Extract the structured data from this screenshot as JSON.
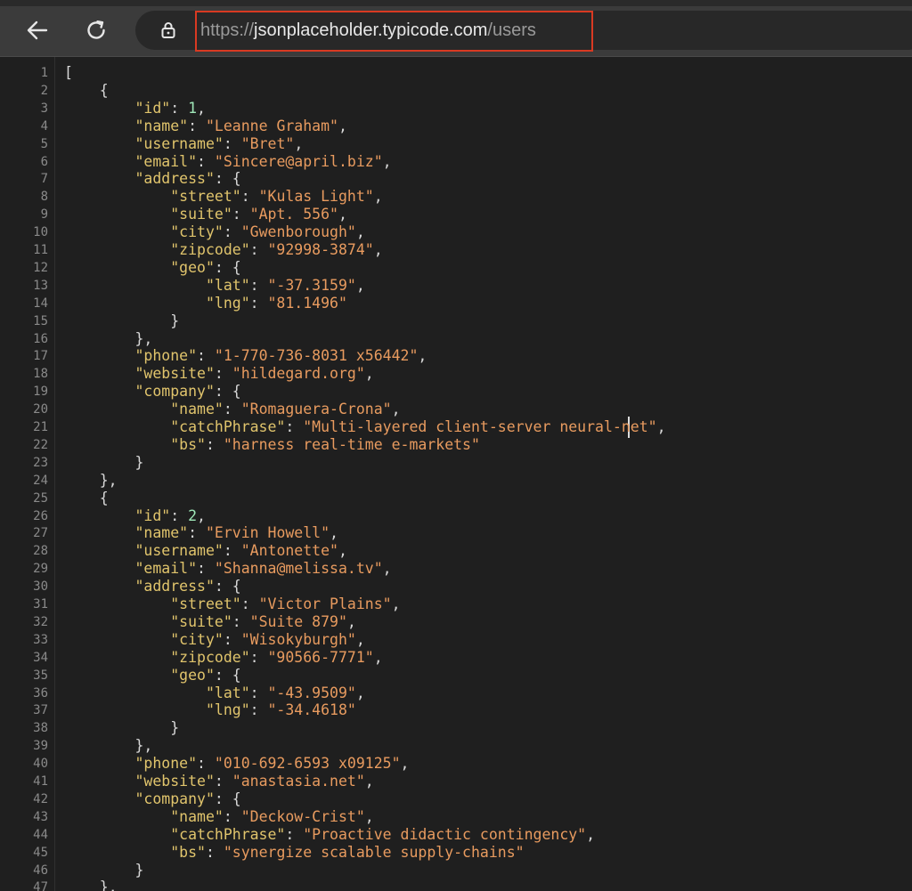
{
  "browser": {
    "url_scheme": "https://",
    "url_host": "jsonplaceholder.typicode.com",
    "url_path": "/users",
    "back_icon": "arrow-left-icon",
    "reload_icon": "reload-icon",
    "lock_icon": "lock-icon",
    "highlight_color": "#d93a22"
  },
  "viewer": {
    "lines": [
      {
        "n": "1",
        "t": [
          {
            "c": "p",
            "v": "["
          }
        ]
      },
      {
        "n": "2",
        "t": [
          {
            "c": "p",
            "v": "    {"
          }
        ]
      },
      {
        "n": "3",
        "t": [
          {
            "c": "p",
            "v": "        "
          },
          {
            "c": "k",
            "v": "\"id\""
          },
          {
            "c": "p",
            "v": ": "
          },
          {
            "c": "n",
            "v": "1"
          },
          {
            "c": "p",
            "v": ","
          }
        ]
      },
      {
        "n": "4",
        "t": [
          {
            "c": "p",
            "v": "        "
          },
          {
            "c": "k",
            "v": "\"name\""
          },
          {
            "c": "p",
            "v": ": "
          },
          {
            "c": "s",
            "v": "\"Leanne Graham\""
          },
          {
            "c": "p",
            "v": ","
          }
        ]
      },
      {
        "n": "5",
        "t": [
          {
            "c": "p",
            "v": "        "
          },
          {
            "c": "k",
            "v": "\"username\""
          },
          {
            "c": "p",
            "v": ": "
          },
          {
            "c": "s",
            "v": "\"Bret\""
          },
          {
            "c": "p",
            "v": ","
          }
        ]
      },
      {
        "n": "6",
        "t": [
          {
            "c": "p",
            "v": "        "
          },
          {
            "c": "k",
            "v": "\"email\""
          },
          {
            "c": "p",
            "v": ": "
          },
          {
            "c": "s",
            "v": "\"Sincere@april.biz\""
          },
          {
            "c": "p",
            "v": ","
          }
        ]
      },
      {
        "n": "7",
        "t": [
          {
            "c": "p",
            "v": "        "
          },
          {
            "c": "k",
            "v": "\"address\""
          },
          {
            "c": "p",
            "v": ": {"
          }
        ]
      },
      {
        "n": "8",
        "t": [
          {
            "c": "p",
            "v": "            "
          },
          {
            "c": "k",
            "v": "\"street\""
          },
          {
            "c": "p",
            "v": ": "
          },
          {
            "c": "s",
            "v": "\"Kulas Light\""
          },
          {
            "c": "p",
            "v": ","
          }
        ]
      },
      {
        "n": "9",
        "t": [
          {
            "c": "p",
            "v": "            "
          },
          {
            "c": "k",
            "v": "\"suite\""
          },
          {
            "c": "p",
            "v": ": "
          },
          {
            "c": "s",
            "v": "\"Apt. 556\""
          },
          {
            "c": "p",
            "v": ","
          }
        ]
      },
      {
        "n": "10",
        "t": [
          {
            "c": "p",
            "v": "            "
          },
          {
            "c": "k",
            "v": "\"city\""
          },
          {
            "c": "p",
            "v": ": "
          },
          {
            "c": "s",
            "v": "\"Gwenborough\""
          },
          {
            "c": "p",
            "v": ","
          }
        ]
      },
      {
        "n": "11",
        "t": [
          {
            "c": "p",
            "v": "            "
          },
          {
            "c": "k",
            "v": "\"zipcode\""
          },
          {
            "c": "p",
            "v": ": "
          },
          {
            "c": "s",
            "v": "\"92998-3874\""
          },
          {
            "c": "p",
            "v": ","
          }
        ]
      },
      {
        "n": "12",
        "t": [
          {
            "c": "p",
            "v": "            "
          },
          {
            "c": "k",
            "v": "\"geo\""
          },
          {
            "c": "p",
            "v": ": {"
          }
        ]
      },
      {
        "n": "13",
        "t": [
          {
            "c": "p",
            "v": "                "
          },
          {
            "c": "k",
            "v": "\"lat\""
          },
          {
            "c": "p",
            "v": ": "
          },
          {
            "c": "s",
            "v": "\"-37.3159\""
          },
          {
            "c": "p",
            "v": ","
          }
        ]
      },
      {
        "n": "14",
        "t": [
          {
            "c": "p",
            "v": "                "
          },
          {
            "c": "k",
            "v": "\"lng\""
          },
          {
            "c": "p",
            "v": ": "
          },
          {
            "c": "s",
            "v": "\"81.1496\""
          }
        ]
      },
      {
        "n": "15",
        "t": [
          {
            "c": "p",
            "v": "            }"
          }
        ]
      },
      {
        "n": "16",
        "t": [
          {
            "c": "p",
            "v": "        },"
          }
        ]
      },
      {
        "n": "17",
        "t": [
          {
            "c": "p",
            "v": "        "
          },
          {
            "c": "k",
            "v": "\"phone\""
          },
          {
            "c": "p",
            "v": ": "
          },
          {
            "c": "s",
            "v": "\"1-770-736-8031 x56442\""
          },
          {
            "c": "p",
            "v": ","
          }
        ]
      },
      {
        "n": "18",
        "t": [
          {
            "c": "p",
            "v": "        "
          },
          {
            "c": "k",
            "v": "\"website\""
          },
          {
            "c": "p",
            "v": ": "
          },
          {
            "c": "s",
            "v": "\"hildegard.org\""
          },
          {
            "c": "p",
            "v": ","
          }
        ]
      },
      {
        "n": "19",
        "t": [
          {
            "c": "p",
            "v": "        "
          },
          {
            "c": "k",
            "v": "\"company\""
          },
          {
            "c": "p",
            "v": ": {"
          }
        ]
      },
      {
        "n": "20",
        "t": [
          {
            "c": "p",
            "v": "            "
          },
          {
            "c": "k",
            "v": "\"name\""
          },
          {
            "c": "p",
            "v": ": "
          },
          {
            "c": "s",
            "v": "\"Romaguera-Crona\""
          },
          {
            "c": "p",
            "v": ","
          }
        ]
      },
      {
        "n": "21",
        "t": [
          {
            "c": "p",
            "v": "            "
          },
          {
            "c": "k",
            "v": "\"catchPhrase\""
          },
          {
            "c": "p",
            "v": ": "
          },
          {
            "c": "s",
            "v": "\"Multi-layered client-server neural-net\""
          },
          {
            "c": "p",
            "v": ","
          }
        ]
      },
      {
        "n": "22",
        "t": [
          {
            "c": "p",
            "v": "            "
          },
          {
            "c": "k",
            "v": "\"bs\""
          },
          {
            "c": "p",
            "v": ": "
          },
          {
            "c": "s",
            "v": "\"harness real-time e-markets\""
          }
        ]
      },
      {
        "n": "23",
        "t": [
          {
            "c": "p",
            "v": "        }"
          }
        ]
      },
      {
        "n": "24",
        "t": [
          {
            "c": "p",
            "v": "    },"
          }
        ]
      },
      {
        "n": "25",
        "t": [
          {
            "c": "p",
            "v": "    {"
          }
        ]
      },
      {
        "n": "26",
        "t": [
          {
            "c": "p",
            "v": "        "
          },
          {
            "c": "k",
            "v": "\"id\""
          },
          {
            "c": "p",
            "v": ": "
          },
          {
            "c": "n",
            "v": "2"
          },
          {
            "c": "p",
            "v": ","
          }
        ]
      },
      {
        "n": "27",
        "t": [
          {
            "c": "p",
            "v": "        "
          },
          {
            "c": "k",
            "v": "\"name\""
          },
          {
            "c": "p",
            "v": ": "
          },
          {
            "c": "s",
            "v": "\"Ervin Howell\""
          },
          {
            "c": "p",
            "v": ","
          }
        ]
      },
      {
        "n": "28",
        "t": [
          {
            "c": "p",
            "v": "        "
          },
          {
            "c": "k",
            "v": "\"username\""
          },
          {
            "c": "p",
            "v": ": "
          },
          {
            "c": "s",
            "v": "\"Antonette\""
          },
          {
            "c": "p",
            "v": ","
          }
        ]
      },
      {
        "n": "29",
        "t": [
          {
            "c": "p",
            "v": "        "
          },
          {
            "c": "k",
            "v": "\"email\""
          },
          {
            "c": "p",
            "v": ": "
          },
          {
            "c": "s",
            "v": "\"Shanna@melissa.tv\""
          },
          {
            "c": "p",
            "v": ","
          }
        ]
      },
      {
        "n": "30",
        "t": [
          {
            "c": "p",
            "v": "        "
          },
          {
            "c": "k",
            "v": "\"address\""
          },
          {
            "c": "p",
            "v": ": {"
          }
        ]
      },
      {
        "n": "31",
        "t": [
          {
            "c": "p",
            "v": "            "
          },
          {
            "c": "k",
            "v": "\"street\""
          },
          {
            "c": "p",
            "v": ": "
          },
          {
            "c": "s",
            "v": "\"Victor Plains\""
          },
          {
            "c": "p",
            "v": ","
          }
        ]
      },
      {
        "n": "32",
        "t": [
          {
            "c": "p",
            "v": "            "
          },
          {
            "c": "k",
            "v": "\"suite\""
          },
          {
            "c": "p",
            "v": ": "
          },
          {
            "c": "s",
            "v": "\"Suite 879\""
          },
          {
            "c": "p",
            "v": ","
          }
        ]
      },
      {
        "n": "33",
        "t": [
          {
            "c": "p",
            "v": "            "
          },
          {
            "c": "k",
            "v": "\"city\""
          },
          {
            "c": "p",
            "v": ": "
          },
          {
            "c": "s",
            "v": "\"Wisokyburgh\""
          },
          {
            "c": "p",
            "v": ","
          }
        ]
      },
      {
        "n": "34",
        "t": [
          {
            "c": "p",
            "v": "            "
          },
          {
            "c": "k",
            "v": "\"zipcode\""
          },
          {
            "c": "p",
            "v": ": "
          },
          {
            "c": "s",
            "v": "\"90566-7771\""
          },
          {
            "c": "p",
            "v": ","
          }
        ]
      },
      {
        "n": "35",
        "t": [
          {
            "c": "p",
            "v": "            "
          },
          {
            "c": "k",
            "v": "\"geo\""
          },
          {
            "c": "p",
            "v": ": {"
          }
        ]
      },
      {
        "n": "36",
        "t": [
          {
            "c": "p",
            "v": "                "
          },
          {
            "c": "k",
            "v": "\"lat\""
          },
          {
            "c": "p",
            "v": ": "
          },
          {
            "c": "s",
            "v": "\"-43.9509\""
          },
          {
            "c": "p",
            "v": ","
          }
        ]
      },
      {
        "n": "37",
        "t": [
          {
            "c": "p",
            "v": "                "
          },
          {
            "c": "k",
            "v": "\"lng\""
          },
          {
            "c": "p",
            "v": ": "
          },
          {
            "c": "s",
            "v": "\"-34.4618\""
          }
        ]
      },
      {
        "n": "38",
        "t": [
          {
            "c": "p",
            "v": "            }"
          }
        ]
      },
      {
        "n": "39",
        "t": [
          {
            "c": "p",
            "v": "        },"
          }
        ]
      },
      {
        "n": "40",
        "t": [
          {
            "c": "p",
            "v": "        "
          },
          {
            "c": "k",
            "v": "\"phone\""
          },
          {
            "c": "p",
            "v": ": "
          },
          {
            "c": "s",
            "v": "\"010-692-6593 x09125\""
          },
          {
            "c": "p",
            "v": ","
          }
        ]
      },
      {
        "n": "41",
        "t": [
          {
            "c": "p",
            "v": "        "
          },
          {
            "c": "k",
            "v": "\"website\""
          },
          {
            "c": "p",
            "v": ": "
          },
          {
            "c": "s",
            "v": "\"anastasia.net\""
          },
          {
            "c": "p",
            "v": ","
          }
        ]
      },
      {
        "n": "42",
        "t": [
          {
            "c": "p",
            "v": "        "
          },
          {
            "c": "k",
            "v": "\"company\""
          },
          {
            "c": "p",
            "v": ": {"
          }
        ]
      },
      {
        "n": "43",
        "t": [
          {
            "c": "p",
            "v": "            "
          },
          {
            "c": "k",
            "v": "\"name\""
          },
          {
            "c": "p",
            "v": ": "
          },
          {
            "c": "s",
            "v": "\"Deckow-Crist\""
          },
          {
            "c": "p",
            "v": ","
          }
        ]
      },
      {
        "n": "44",
        "t": [
          {
            "c": "p",
            "v": "            "
          },
          {
            "c": "k",
            "v": "\"catchPhrase\""
          },
          {
            "c": "p",
            "v": ": "
          },
          {
            "c": "s",
            "v": "\"Proactive didactic contingency\""
          },
          {
            "c": "p",
            "v": ","
          }
        ]
      },
      {
        "n": "45",
        "t": [
          {
            "c": "p",
            "v": "            "
          },
          {
            "c": "k",
            "v": "\"bs\""
          },
          {
            "c": "p",
            "v": ": "
          },
          {
            "c": "s",
            "v": "\"synergize scalable supply-chains\""
          }
        ]
      },
      {
        "n": "46",
        "t": [
          {
            "c": "p",
            "v": "        }"
          }
        ]
      },
      {
        "n": "47",
        "t": [
          {
            "c": "p",
            "v": "    },"
          }
        ]
      }
    ]
  }
}
